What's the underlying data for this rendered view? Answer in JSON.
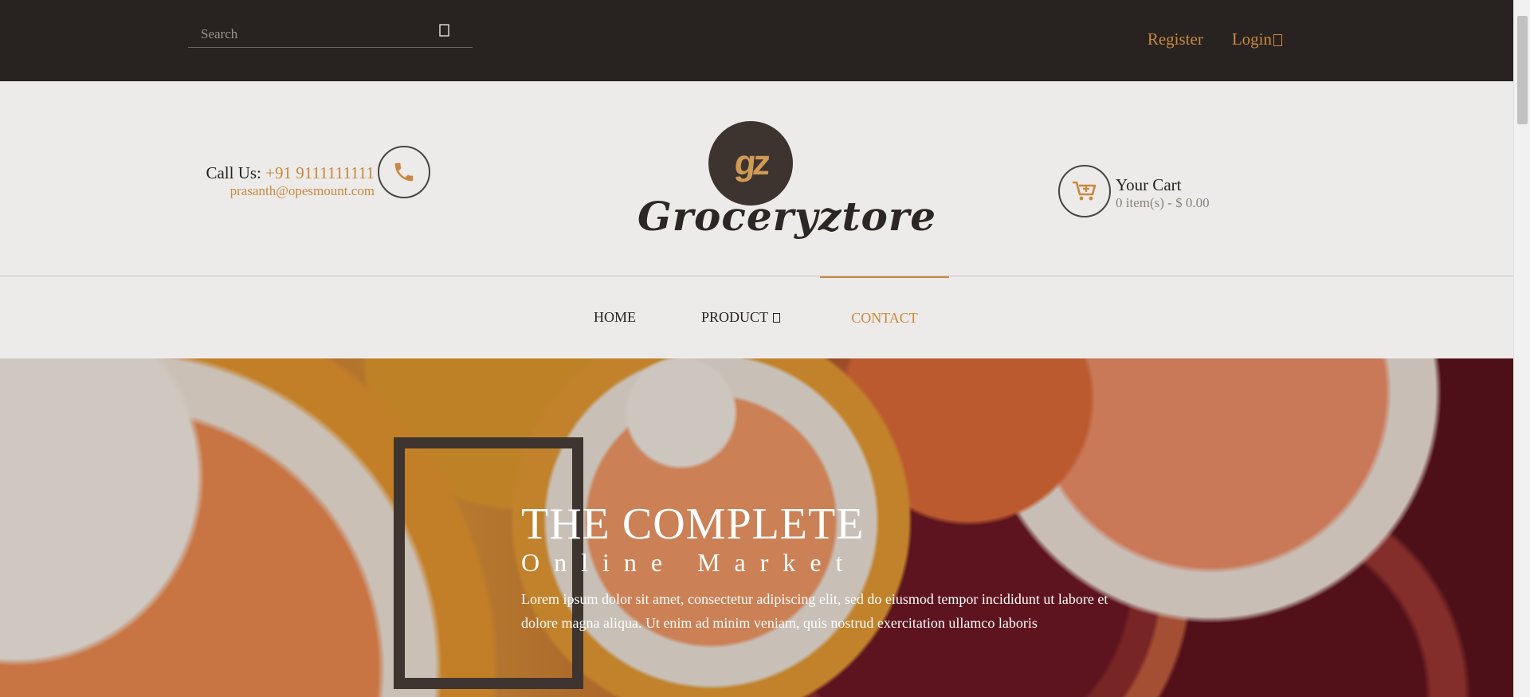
{
  "topbar": {
    "search_placeholder": "Search",
    "search_icon": "search-icon",
    "register_label": "Register",
    "login_label": "Login",
    "login_icon": "user-icon"
  },
  "header": {
    "call_label": "Call Us:",
    "call_number": "+91 9111111111",
    "email": "prasanth@opesmount.com",
    "phone_icon": "phone-icon",
    "logo_mark": "gz",
    "logo_text": "Groceryztore",
    "cart_icon": "cart-icon",
    "cart_title": "Your Cart",
    "cart_summary": "0 item(s) - $ 0.00"
  },
  "nav": {
    "items": [
      {
        "label": "HOME"
      },
      {
        "label": "PRODUCT"
      },
      {
        "label": "CONTACT"
      }
    ],
    "active": "CONTACT"
  },
  "hero": {
    "title": "THE COMPLETE",
    "subtitle": "Online Market",
    "body": "Lorem ipsum dolor sit amet, consectetur adipiscing elit, sed do eiusmod tempor incididunt ut labore et dolore magna aliqua. Ut enim ad minim veniam, quis nostrud exercitation ullamco laboris"
  },
  "colors": {
    "topbar_bg": "#282320",
    "accent": "#c9883f",
    "header_bg": "#edebe9",
    "text_dark": "#282320"
  }
}
